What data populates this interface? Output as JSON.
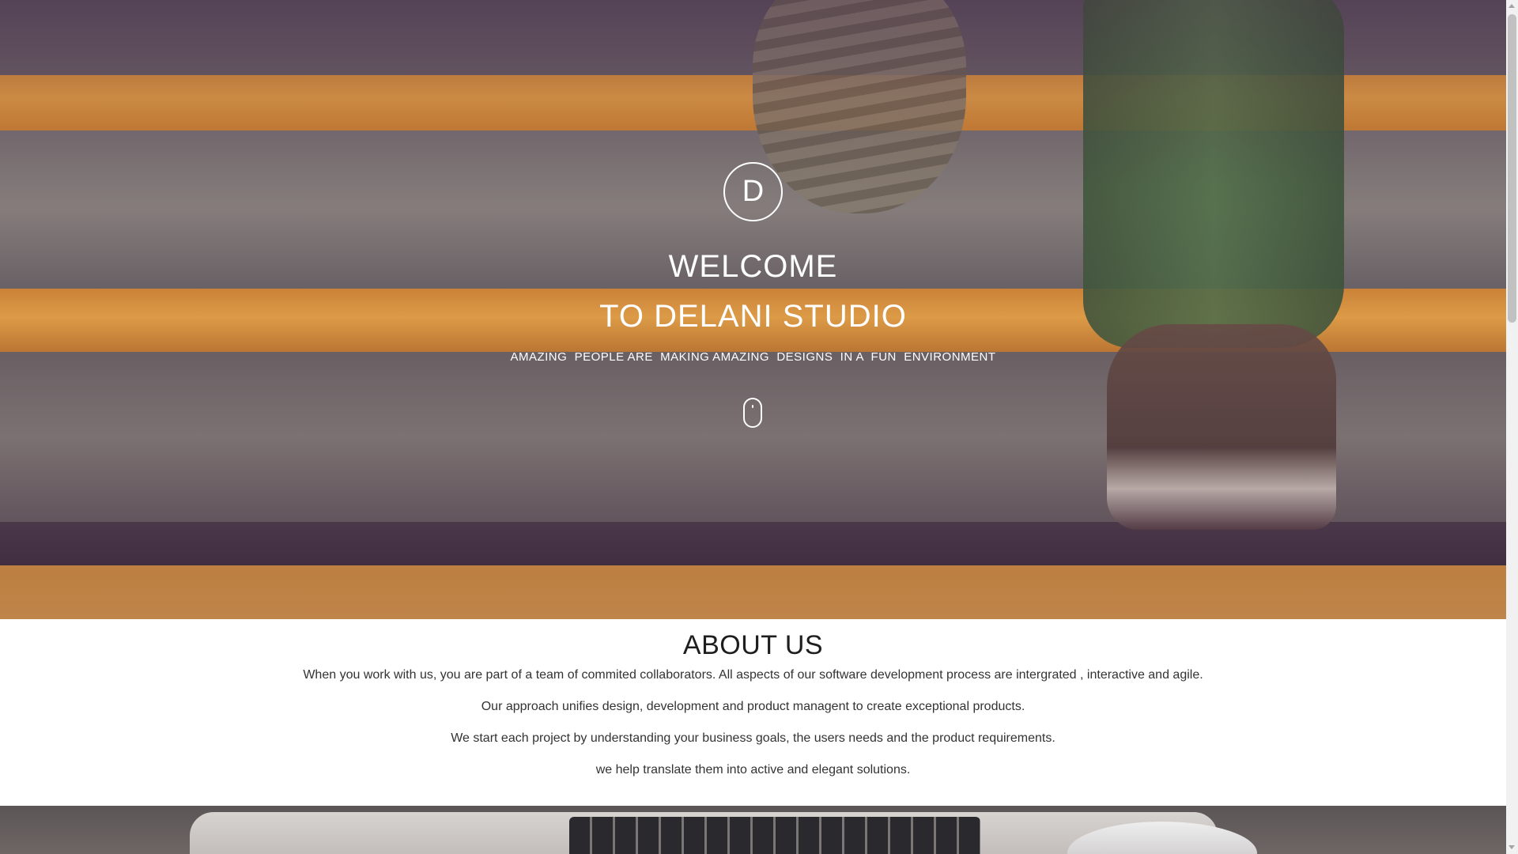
{
  "hero": {
    "logo_letter": "D",
    "title_line_1": "WELCOME",
    "title_line_2": "TO  DELANI STUDIO",
    "tagline": "AMAZING  PEOPLE ARE  MAKING AMAZING  DESIGNS  IN A  FUN  ENVIRONMENT",
    "scroll_icon": "mouse-icon"
  },
  "about": {
    "heading": "ABOUT US",
    "paragraphs": [
      "When you work with us, you are part of a team of commited collaborators. All aspects of our software development process are intergrated , interactive and agile.",
      "Our approach unifies design, development and product managent to create exceptional products.",
      "We start each project by understanding your business goals, the users needs and the product requirements.",
      "we help translate them into active and elegant solutions."
    ]
  },
  "colors": {
    "hero_text": "#ffffff",
    "stair_orange": "#f0a944",
    "about_bg": "#ffffff",
    "heading_text": "#1e1e1e"
  }
}
